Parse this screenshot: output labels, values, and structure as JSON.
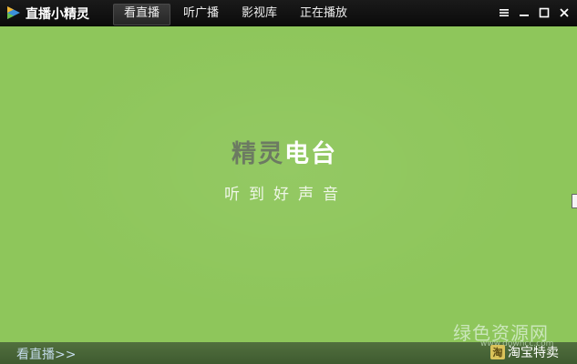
{
  "app": {
    "title": "直播小精灵"
  },
  "tabs": [
    {
      "label": "看直播",
      "active": true
    },
    {
      "label": "听广播",
      "active": false
    },
    {
      "label": "影视库",
      "active": false
    },
    {
      "label": "正在播放",
      "active": false
    }
  ],
  "window_controls": [
    "menu-icon",
    "minimize-icon",
    "maximize-icon",
    "close-icon"
  ],
  "main": {
    "brand_part1": "精灵",
    "brand_part2": "电台",
    "slogan": "听到好声音",
    "background_color": "#8ec65b"
  },
  "bottom": {
    "watch_link": "看直播>>",
    "taobao_icon": "淘",
    "taobao_label": "淘宝特卖"
  },
  "watermark": {
    "text": "绿色资源网",
    "url": "www.downcc.com"
  },
  "colors": {
    "titlebar": "#111111",
    "accent_green": "#8ec65b",
    "bottombar": "#4a6638"
  }
}
